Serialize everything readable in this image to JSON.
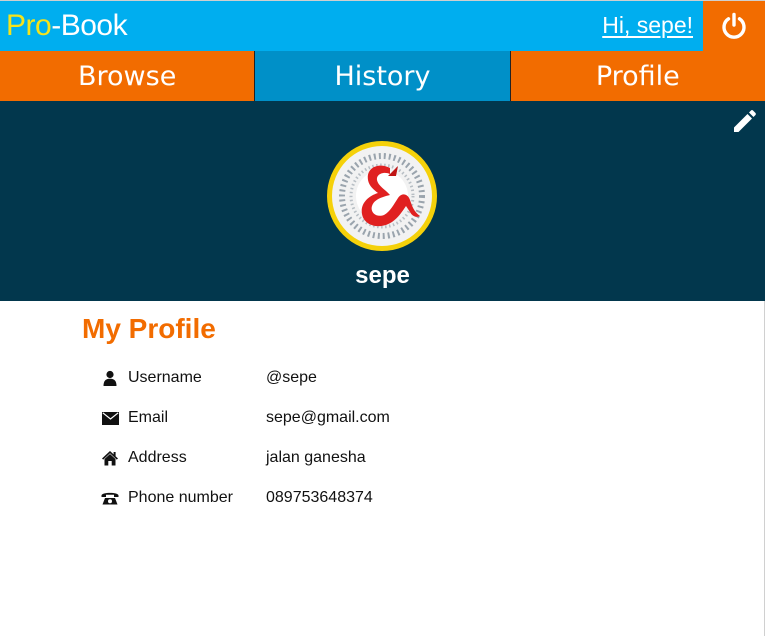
{
  "header": {
    "brand": {
      "pro": "Pro",
      "dash": "-",
      "book": "Book"
    },
    "greeting": "Hi, sepe!",
    "logout_icon": "power-icon"
  },
  "nav": {
    "tabs": [
      {
        "label": "Browse",
        "active": false
      },
      {
        "label": "History",
        "active": true
      },
      {
        "label": "Profile",
        "active": false
      }
    ]
  },
  "profile_header": {
    "name": "sepe",
    "edit_icon": "pencil-icon",
    "avatar_icon": "ampersand-dragon-logo"
  },
  "profile": {
    "title": "My Profile",
    "fields": [
      {
        "icon": "user-icon",
        "label": "Username",
        "value": "@sepe"
      },
      {
        "icon": "envelope-icon",
        "label": "Email",
        "value": "sepe@gmail.com"
      },
      {
        "icon": "home-icon",
        "label": "Address",
        "value": "jalan ganesha"
      },
      {
        "icon": "phone-icon",
        "label": "Phone number",
        "value": "089753648374"
      }
    ]
  },
  "colors": {
    "topbar": "#00aeef",
    "accent_orange": "#f26c00",
    "active_tab": "#0090c8",
    "hero_bg": "#02374d",
    "brand_yellow": "#f5e31b",
    "avatar_ring": "#f5d10a"
  }
}
